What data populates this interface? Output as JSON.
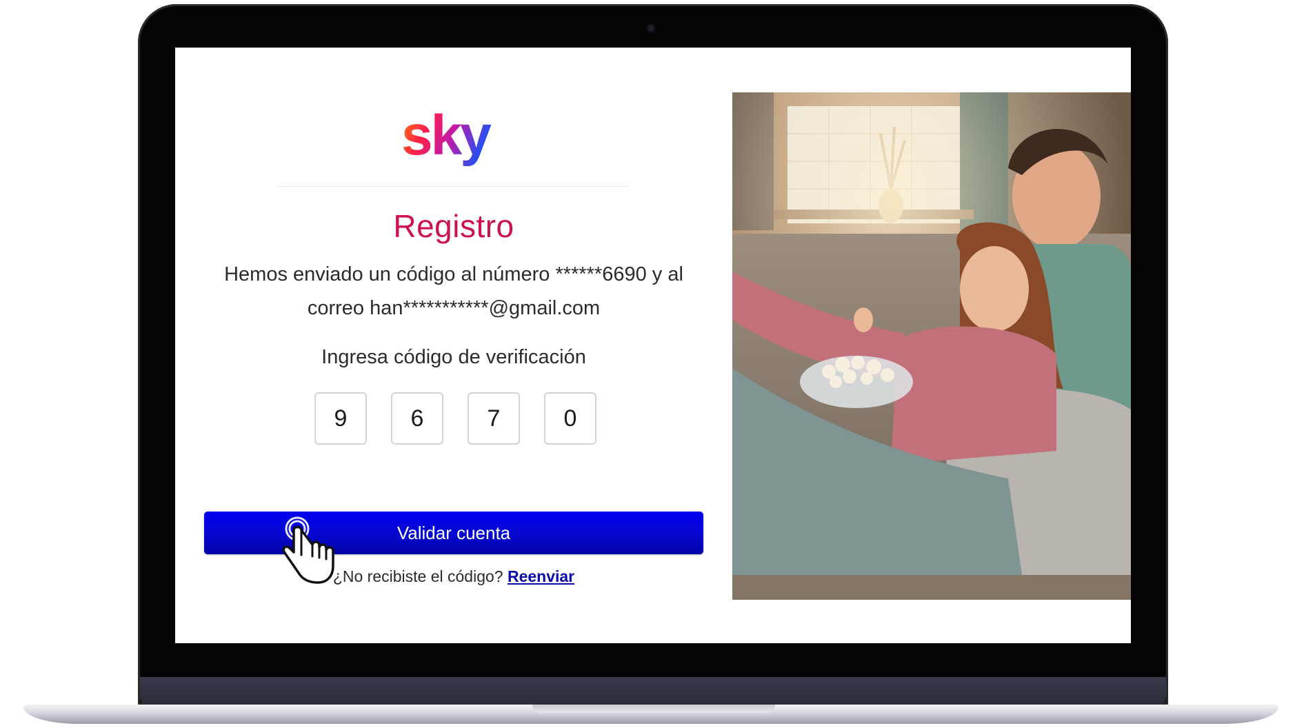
{
  "brand": {
    "logo_text": "sky",
    "title_color": "#cc1155",
    "button_color": "#0707d2",
    "link_color": "#0a0aa8"
  },
  "registration": {
    "title": "Registro",
    "message_line1": "Hemos enviado un código al número ******6690 y al",
    "message_line2": "correo han***********@gmail.com",
    "code_label": "Ingresa código de verificación",
    "code_digits": [
      "9",
      "6",
      "7",
      "0"
    ],
    "validate_button": "Validar cuenta",
    "resend_prompt": "¿No recibiste el código?",
    "resend_link": "Reenviar"
  },
  "icons": {
    "cursor": "hand-pointer-icon"
  }
}
